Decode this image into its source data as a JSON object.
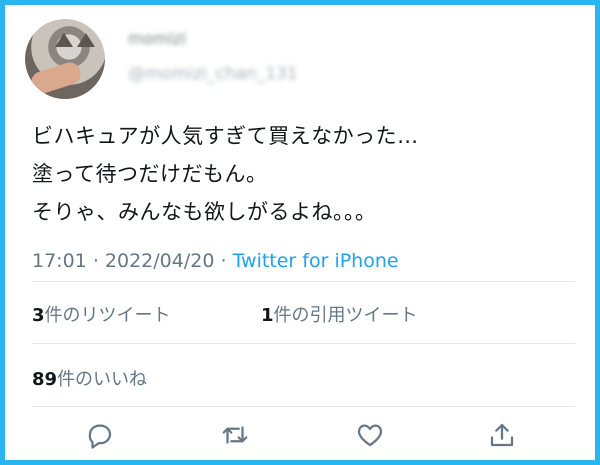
{
  "user": {
    "name": "momizi",
    "handle": "@momizi_chan_131"
  },
  "tweet": {
    "lines": [
      "ビハキュアが人気すぎて買えなかった…",
      "塗って待つだけだもん。",
      "そりゃ、みんなも欲しがるよね。。。"
    ]
  },
  "meta": {
    "time": "17:01",
    "date": "2022/04/20",
    "source": "Twitter for iPhone"
  },
  "stats": {
    "retweets": "3",
    "retweets_label": "件のリツイート",
    "quotes": "1",
    "quotes_label": "件の引用ツイート",
    "likes": "89",
    "likes_label": "件のいいね"
  },
  "actions": [
    "reply-icon",
    "retweet-icon",
    "like-icon",
    "share-icon"
  ],
  "colors": {
    "frame": "#29b6f0",
    "link": "#1da1f2",
    "text": "#14171a",
    "muted": "#657786"
  }
}
